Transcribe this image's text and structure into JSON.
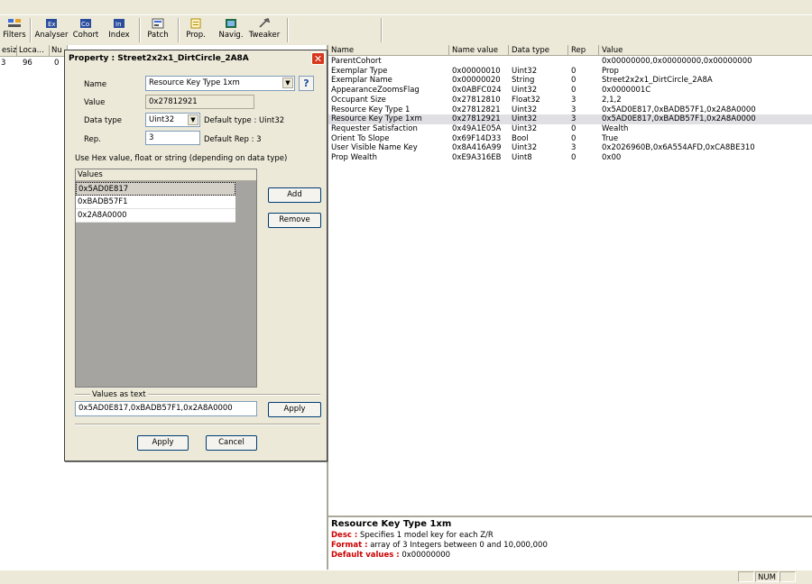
{
  "toolbar": {
    "items": [
      {
        "label": "Filters",
        "icon": "filters-icon"
      },
      {
        "label": "Analyser",
        "icon": "analyser-icon"
      },
      {
        "label": "Cohort",
        "icon": "cohort-icon"
      },
      {
        "label": "Index",
        "icon": "index-icon"
      },
      {
        "label": "Patch",
        "icon": "patch-icon"
      },
      {
        "label": "Prop.",
        "icon": "prop-icon"
      },
      {
        "label": "Navig.",
        "icon": "navig-icon"
      },
      {
        "label": "Tweaker",
        "icon": "tweaker-icon"
      }
    ]
  },
  "left_list": {
    "headers": [
      "esize",
      "Loca...",
      "Nu"
    ],
    "row": [
      "3",
      "96",
      "0"
    ]
  },
  "dialog": {
    "title": "Property : Street2x2x1_DirtCircle_2A8A",
    "close": "✕",
    "name_label": "Name",
    "name_value": "Resource Key Type 1xm",
    "help": "?",
    "value_label": "Value",
    "value_value": "0x27812921",
    "datatype_label": "Data type",
    "datatype_value": "Uint32",
    "default_type": "Default type :  Uint32",
    "rep_label": "Rep.",
    "rep_value": "3",
    "default_rep": "Default Rep :  3",
    "hint": "Use Hex value, float or string (depending on data type)",
    "values_header": "Values",
    "values": [
      "0x5AD0E817",
      "0xBADB57F1",
      "0x2A8A0000"
    ],
    "add": "Add",
    "remove": "Remove",
    "values_as_text_label": "Values as text",
    "values_as_text": "0x5AD0E817,0xBADB57F1,0x2A8A0000",
    "apply_text": "Apply",
    "apply": "Apply",
    "cancel": "Cancel"
  },
  "table": {
    "headers": [
      "Name",
      "Name value",
      "Data type",
      "Rep",
      "Value"
    ],
    "rows": [
      [
        "ParentCohort",
        "",
        "",
        "",
        "0x00000000,0x00000000,0x00000000"
      ],
      [
        "Exemplar Type",
        "0x00000010",
        "Uint32",
        "0",
        "Prop"
      ],
      [
        "Exemplar Name",
        "0x00000020",
        "String",
        "0",
        "Street2x2x1_DirtCircle_2A8A"
      ],
      [
        "AppearanceZoomsFlag",
        "0x0ABFC024",
        "Uint32",
        "0",
        "0x0000001C"
      ],
      [
        "Occupant Size",
        "0x27812810",
        "Float32",
        "3",
        "2,1,2"
      ],
      [
        "Resource Key Type 1",
        "0x27812821",
        "Uint32",
        "3",
        "0x5AD0E817,0xBADB57F1,0x2A8A0000"
      ],
      [
        "Resource Key Type 1xm",
        "0x27812921",
        "Uint32",
        "3",
        "0x5AD0E817,0xBADB57F1,0x2A8A0000"
      ],
      [
        "Requester Satisfaction",
        "0x49A1E05A",
        "Uint32",
        "0",
        "Wealth"
      ],
      [
        "Orient To Slope",
        "0x69F14D33",
        "Bool",
        "0",
        "True"
      ],
      [
        "User Visible Name Key",
        "0x8A416A99",
        "Uint32",
        "3",
        "0x2026960B,0x6A554AFD,0xCA8BE310"
      ],
      [
        "Prop Wealth",
        "0xE9A316EB",
        "Uint8",
        "0",
        "0x00"
      ]
    ],
    "selected_index": 6
  },
  "description": {
    "title": "Resource Key Type 1xm",
    "desc_label": "Desc :",
    "desc": " Specifies 1 model key for each Z/R",
    "format_label": "Format :",
    "format": " array of 3 Integers between 0 and 10,000,000",
    "default_label": "Default values :",
    "default": " 0x00000000"
  },
  "status": {
    "num": "NUM"
  },
  "colors": {
    "label_red": "#cc0000",
    "selection": "#e0dfe3"
  }
}
